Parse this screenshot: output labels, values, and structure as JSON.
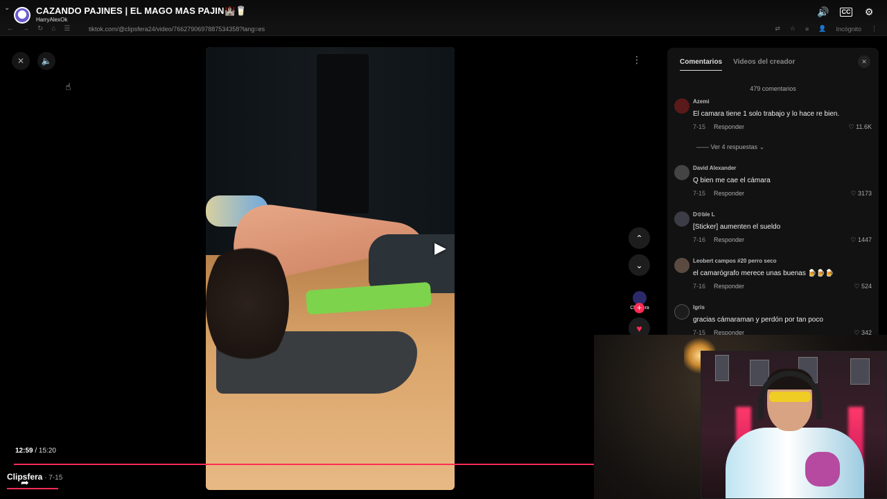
{
  "youtube": {
    "title": "CAZANDO PAJINES | EL MAGO MAS PAJIN🏰🥛",
    "channel": "HarryAlexOk",
    "icons": [
      "volume-icon",
      "captions-icon",
      "settings-icon"
    ]
  },
  "browser": {
    "url": "tiktok.com/@clipsfera24/video/7662790697887534358?lang=es",
    "profile_label": "Incógnito"
  },
  "player": {
    "current_time": "12:59",
    "separator": " / ",
    "total_time": "15:20",
    "progress_fraction": 0.847,
    "creator_name": "Clipsfera",
    "creator_date": " · 7-15",
    "sidebar_creator": "Clipsfera",
    "follow_label": "+"
  },
  "comments_panel": {
    "tabs": [
      {
        "label": "Comentarios",
        "active": true
      },
      {
        "label": "Videos del creador",
        "active": false
      }
    ],
    "count_label": "479 comentarios",
    "view_replies_label": "Ver 4 respuestas",
    "reply_label": "Responder",
    "comments": [
      {
        "user": "Azemi",
        "text": "El camara tiene 1 solo trabajo y lo hace re bien.",
        "date": "7-15",
        "likes": "11.6K"
      },
      {
        "user": "David Alexander",
        "text": "Q bien me cae el cámara",
        "date": "7-15",
        "likes": "3173"
      },
      {
        "user": "D⚙ble L",
        "text": "[Sticker] aumenten el sueldo",
        "date": "7-16",
        "likes": "1447"
      },
      {
        "user": "Leobert campos #20 perro seco",
        "text": "el camarógrafo merece unas buenas 🍺🍺🍺",
        "date": "7-16",
        "likes": "524"
      },
      {
        "user": "lgris",
        "text": "gracias cámaraman y perdón por tan poco",
        "date": "7-15",
        "likes": "342"
      }
    ]
  },
  "colors": {
    "accent": "#fe2c55",
    "panel_bg": "#121212",
    "page_bg": "#000000"
  }
}
